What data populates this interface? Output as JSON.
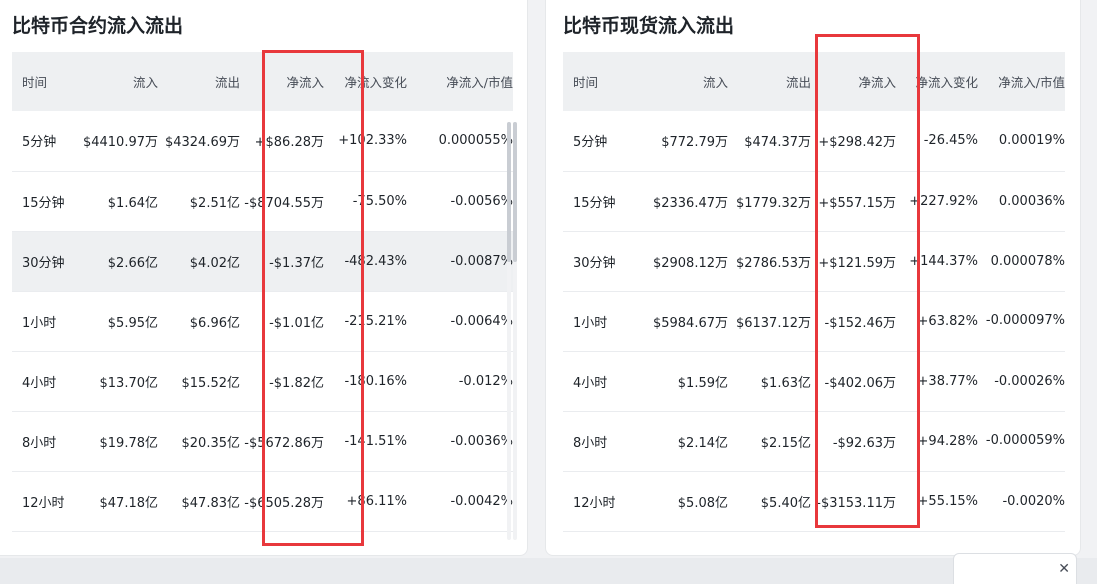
{
  "left_panel": {
    "title": "比特币合约流入流出",
    "headers": [
      "时间",
      "流入",
      "流出",
      "净流入",
      "净流入变化",
      "净流入/市值"
    ],
    "rows": [
      {
        "time": "5分钟",
        "inflow": "$4410.97万",
        "outflow": "$4324.69万",
        "net": "+$86.28万",
        "change": "+102.33%",
        "ratio": "0.000055%"
      },
      {
        "time": "15分钟",
        "inflow": "$1.64亿",
        "outflow": "$2.51亿",
        "net": "-$8704.55万",
        "change": "-75.50%",
        "ratio": "-0.0056%"
      },
      {
        "time": "30分钟",
        "inflow": "$2.66亿",
        "outflow": "$4.02亿",
        "net": "-$1.37亿",
        "change": "-482.43%",
        "ratio": "-0.0087%"
      },
      {
        "time": "1小时",
        "inflow": "$5.95亿",
        "outflow": "$6.96亿",
        "net": "-$1.01亿",
        "change": "-215.21%",
        "ratio": "-0.0064%"
      },
      {
        "time": "4小时",
        "inflow": "$13.70亿",
        "outflow": "$15.52亿",
        "net": "-$1.82亿",
        "change": "-180.16%",
        "ratio": "-0.012%"
      },
      {
        "time": "8小时",
        "inflow": "$19.78亿",
        "outflow": "$20.35亿",
        "net": "-$5672.86万",
        "change": "-141.51%",
        "ratio": "-0.0036%"
      },
      {
        "time": "12小时",
        "inflow": "$47.18亿",
        "outflow": "$47.83亿",
        "net": "-$6505.28万",
        "change": "+86.11%",
        "ratio": "-0.0042%"
      }
    ]
  },
  "right_panel": {
    "title": "比特币现货流入流出",
    "headers": [
      "时间",
      "流入",
      "流出",
      "净流入",
      "净流入变化",
      "净流入/市值"
    ],
    "rows": [
      {
        "time": "5分钟",
        "inflow": "$772.79万",
        "outflow": "$474.37万",
        "net": "+$298.42万",
        "change": "-26.45%",
        "ratio": "0.00019%"
      },
      {
        "time": "15分钟",
        "inflow": "$2336.47万",
        "outflow": "$1779.32万",
        "net": "+$557.15万",
        "change": "+227.92%",
        "ratio": "0.00036%"
      },
      {
        "time": "30分钟",
        "inflow": "$2908.12万",
        "outflow": "$2786.53万",
        "net": "+$121.59万",
        "change": "+144.37%",
        "ratio": "0.000078%"
      },
      {
        "time": "1小时",
        "inflow": "$5984.67万",
        "outflow": "$6137.12万",
        "net": "-$152.46万",
        "change": "+63.82%",
        "ratio": "-0.000097%"
      },
      {
        "time": "4小时",
        "inflow": "$1.59亿",
        "outflow": "$1.63亿",
        "net": "-$402.06万",
        "change": "+38.77%",
        "ratio": "-0.00026%"
      },
      {
        "time": "8小时",
        "inflow": "$2.14亿",
        "outflow": "$2.15亿",
        "net": "-$92.63万",
        "change": "+94.28%",
        "ratio": "-0.000059%"
      },
      {
        "time": "12小时",
        "inflow": "$5.08亿",
        "outflow": "$5.40亿",
        "net": "-$3153.11万",
        "change": "+55.15%",
        "ratio": "-0.0020%"
      }
    ]
  },
  "colors": {
    "positive": "#2ea37e",
    "negative": "#e0424c",
    "highlight_box": "#e8383c",
    "header_bg": "#eef0f2"
  },
  "icons": {
    "close": "close-icon"
  },
  "close_glyph": "✕"
}
